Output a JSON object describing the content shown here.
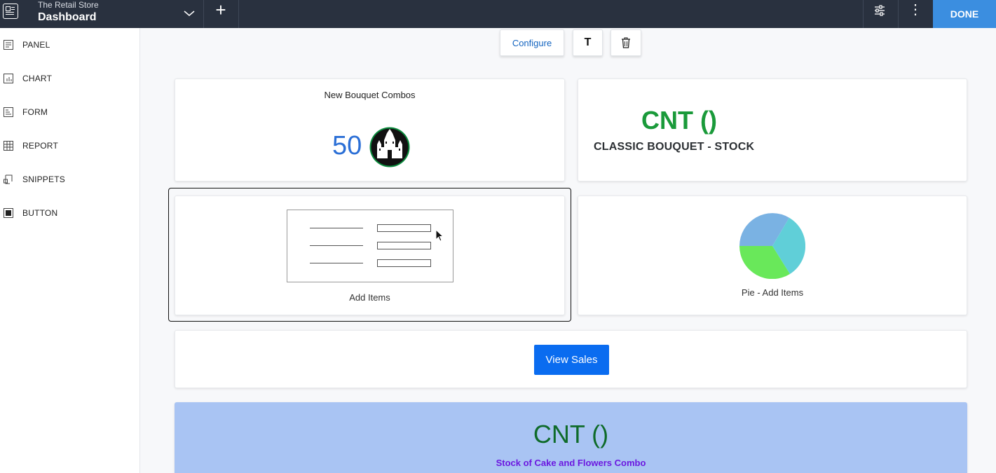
{
  "header": {
    "app_name": "The Retail Store",
    "title": "Dashboard",
    "add_label": "+",
    "more_label": "⋮",
    "done_label": "DONE"
  },
  "sidebar": {
    "items": [
      {
        "label": "PANEL",
        "icon": "panel-icon"
      },
      {
        "label": "CHART",
        "icon": "chart-icon"
      },
      {
        "label": "FORM",
        "icon": "form-icon"
      },
      {
        "label": "REPORT",
        "icon": "report-icon"
      },
      {
        "label": "SNIPPETS",
        "icon": "snippets-icon"
      },
      {
        "label": "BUTTON",
        "icon": "button-icon"
      }
    ]
  },
  "toolbar": {
    "configure_label": "Configure",
    "text_label": "T"
  },
  "widgets": {
    "kpi_bouquet": {
      "title": "New Bouquet Combos",
      "value": "50"
    },
    "kpi_classic": {
      "value": "CNT ()",
      "label": "CLASSIC BOUQUET - STOCK"
    },
    "form_add_items": {
      "caption": "Add Items"
    },
    "pie_add_items": {
      "caption": "Pie - Add Items"
    },
    "view_sales": {
      "label": "View Sales"
    },
    "kpi_cake": {
      "value": "CNT ()",
      "label": "Stock of Cake and Flowers Combo"
    }
  },
  "colors": {
    "topbar": "#29313f",
    "done": "#3b8ee0",
    "kpi_blue": "#2b6fd6",
    "kpi_green": "#1a9a3a",
    "button_blue": "#0a6cf0",
    "banner_bg": "#a9c4f3",
    "pie_blue": "#7ab2e3",
    "pie_teal": "#60cfd8",
    "pie_green": "#69e85a"
  }
}
